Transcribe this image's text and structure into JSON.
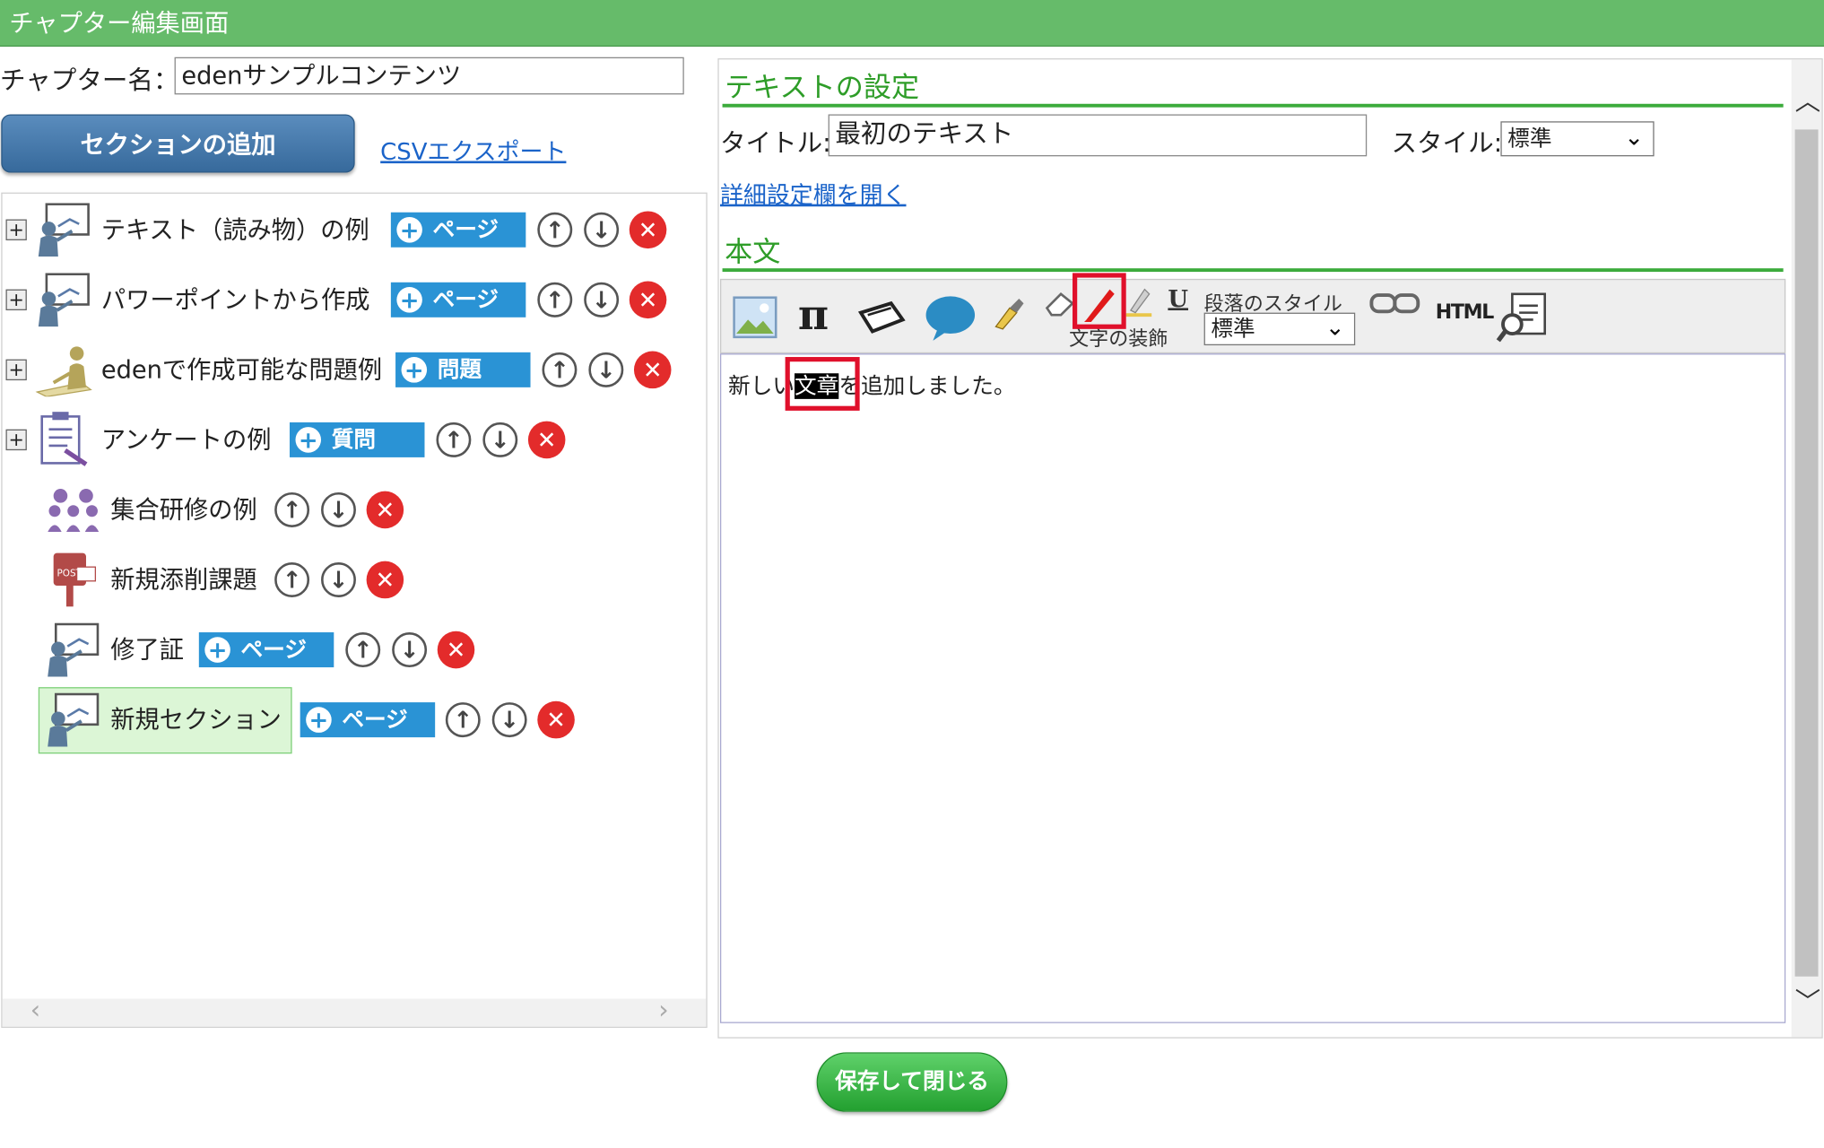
{
  "window": {
    "title": "チャプター編集画面"
  },
  "chapter": {
    "name_label": "チャプター名：",
    "name_value": "edenサンプルコンテンツ"
  },
  "left_toolbar": {
    "add_section": "セクションの追加",
    "csv_export": "CSVエクスポート"
  },
  "sections": [
    {
      "label": "テキスト（読み物）の例",
      "icon": "presentation-icon",
      "add": "ページ"
    },
    {
      "label": "パワーポイントから作成",
      "icon": "presentation-icon",
      "add": "ページ"
    },
    {
      "label": "edenで作成可能な問題例",
      "icon": "exam-icon",
      "add": "問題"
    },
    {
      "label": "アンケートの例",
      "icon": "clipboard-icon",
      "add": "質問"
    },
    {
      "label": "集合研修の例",
      "icon": "group-icon"
    },
    {
      "label": "新規添削課題",
      "icon": "postbox-icon"
    },
    {
      "label": "修了証",
      "icon": "presentation-icon",
      "add": "ページ"
    },
    {
      "label": "新規セクション",
      "icon": "presentation-icon",
      "add": "ページ",
      "selected": true
    }
  ],
  "text_settings": {
    "heading": "テキストの設定",
    "title_label": "タイトル:",
    "title_value": "最初のテキスト",
    "style_label": "スタイル:",
    "style_value": "標準",
    "details_link": "詳細設定欄を開く",
    "body_heading": "本文"
  },
  "editor_toolbar": {
    "text_decoration_label": "文字の装飾",
    "paragraph_style_label": "段落のスタイル",
    "paragraph_style_value": "標準",
    "html_label": "HTML",
    "pi_symbol": "π",
    "underline_symbol": "U"
  },
  "editor": {
    "before": "新しい",
    "highlight": "文章",
    "after": "を追加しました。"
  },
  "footer": {
    "save_close": "保存して閉じる"
  },
  "colors": {
    "titlebar": "#66bb6a",
    "accent_green": "#2e9d28",
    "add_button": "#2a93d5",
    "delete": "#e32b2b",
    "highlight_box": "#e0102b"
  }
}
